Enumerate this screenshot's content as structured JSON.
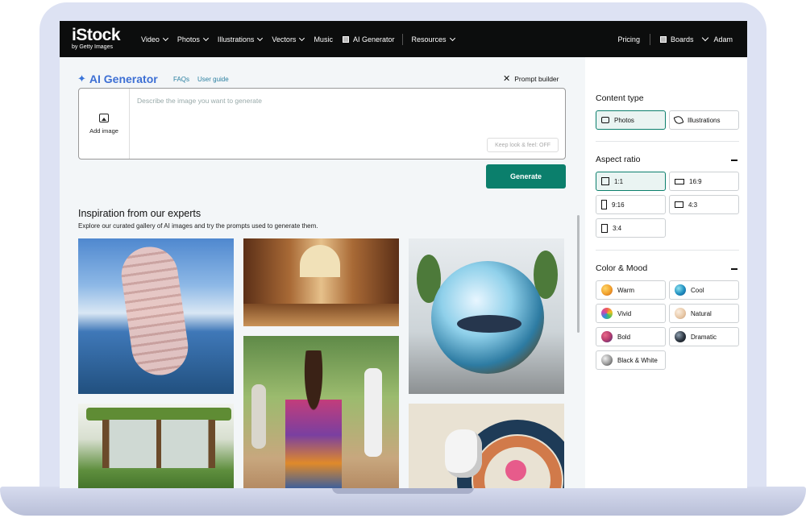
{
  "nav": {
    "logo_main": "iStock",
    "logo_sub": "by Getty Images",
    "items": [
      "Video",
      "Photos",
      "Illustrations",
      "Vectors",
      "Music",
      "AI Generator",
      "Resources"
    ],
    "pricing": "Pricing",
    "boards": "Boards",
    "user": "Adam"
  },
  "generator": {
    "title": "AI Generator",
    "faqs": "FAQs",
    "guide": "User guide",
    "prompt_builder": "Prompt builder",
    "add_image": "Add image",
    "placeholder": "Describe the image you want to generate",
    "keep_look": "Keep look & feel: OFF",
    "generate": "Generate"
  },
  "inspiration": {
    "title": "Inspiration from our experts",
    "subtitle": "Explore our curated gallery of AI images and try the prompts used to generate them."
  },
  "sidebar": {
    "content_type": {
      "title": "Content type",
      "options": [
        {
          "label": "Photos",
          "icon": "camera-icon",
          "selected": true
        },
        {
          "label": "Illustrations",
          "icon": "pen-icon",
          "selected": false
        }
      ]
    },
    "aspect_ratio": {
      "title": "Aspect ratio",
      "options": [
        {
          "label": "1:1",
          "selected": true
        },
        {
          "label": "16:9",
          "selected": false
        },
        {
          "label": "9:16",
          "selected": false
        },
        {
          "label": "4:3",
          "selected": false
        },
        {
          "label": "3:4",
          "selected": false
        }
      ]
    },
    "color_mood": {
      "title": "Color & Mood",
      "options": [
        {
          "label": "Warm",
          "color": "#f0a02c"
        },
        {
          "label": "Cool",
          "color": "#1f8fc0"
        },
        {
          "label": "Vivid",
          "color": "#c74bb0"
        },
        {
          "label": "Natural",
          "color": "#e8c9a8"
        },
        {
          "label": "Bold",
          "color": "#b83d6e"
        },
        {
          "label": "Dramatic",
          "color": "#2c3540"
        },
        {
          "label": "Black & White",
          "color": "#9a9a9a"
        }
      ]
    }
  },
  "colors": {
    "accent": "#0b7f6c",
    "ai_title": "#3d6fd4",
    "nav_bg": "#0c0d0d"
  }
}
